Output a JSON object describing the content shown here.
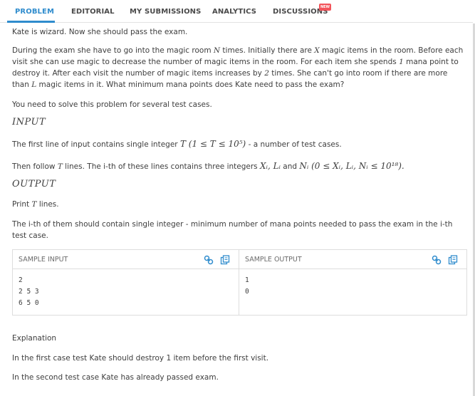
{
  "tabs": {
    "problem": "PROBLEM",
    "editorial": "EDITORIAL",
    "my_submissions": "MY SUBMISSIONS",
    "analytics": "ANALYTICS",
    "discussions": "DISCUSSIONS",
    "new_badge": "NEW"
  },
  "statement": {
    "intro": "Kate is wizard. Now she should pass the exam.",
    "p1_a": "During the exam she have to go into the magic room ",
    "p1_N": "N",
    "p1_b": " times. Initially there are ",
    "p1_X": "X",
    "p1_c": " magic items in the room. Before each",
    "p1_line2": "visit she can use magic to decrease the number of magic items in the room. For each item she spends ",
    "p1_one": "1",
    "p1_line2b": " mana point to",
    "p1_line3a": "destroy it. After each visit the number of magic items increases by ",
    "p1_two": "2",
    "p1_line3b": " times. She can't go into room if there are more",
    "p1_line4a": "than ",
    "p1_L": "L",
    "p1_line4b": " magic items in it. What minimum mana points does Kate need to pass the exam?",
    "several": "You need to solve this problem for several test cases.",
    "input_heading": "INPUT",
    "input_line1_a": "The first line of input contains single integer ",
    "input_line1_math": "T (1 ≤ T ≤ 10⁵)",
    "input_line1_b": " - a number of test cases.",
    "input_line2_a": "Then follow ",
    "input_line2_T": "T",
    "input_line2_b": " lines. The i-th of these lines contains three integers ",
    "input_line2_math1": "Xᵢ, Lᵢ",
    "input_line2_and": " and ",
    "input_line2_math2": "Nᵢ (0 ≤ Xᵢ, Lᵢ, Nᵢ ≤ 10¹⁸).",
    "output_heading": "OUTPUT",
    "output_line1_a": "Print ",
    "output_line1_T": "T",
    "output_line1_b": " lines.",
    "output_line2": "The i-th of them should contain single integer - minimum number of mana points needed to pass the exam in the i-th",
    "output_line3": "test case."
  },
  "samples": {
    "input_label": "SAMPLE INPUT",
    "output_label": "SAMPLE OUTPUT",
    "input_text": "2\n2 5 3\n6 5 0",
    "output_text": "1\n0"
  },
  "explanation": {
    "heading": "Explanation",
    "line1": "In the first case test Kate should destroy 1 item before the first visit.",
    "line2": "In the second test case Kate has already passed exam."
  },
  "colors": {
    "accent": "#2f8ccd",
    "badge": "#f2545b"
  },
  "icons": {
    "link": "link-icon",
    "copy": "copy-icon"
  }
}
